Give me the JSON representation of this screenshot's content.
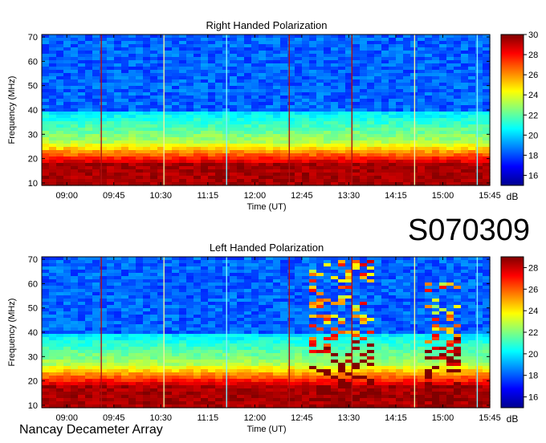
{
  "observation_id": "S070309",
  "observatory": "Nancay Decameter Array",
  "chart_data": [
    {
      "type": "heatmap",
      "title": "Right Handed Polarization",
      "xlabel": "Time (UT)",
      "ylabel": "Frequency (MHz)",
      "x_ticks": [
        "09:00",
        "09:45",
        "10:30",
        "11:15",
        "12:00",
        "12:45",
        "13:30",
        "14:15",
        "15:00",
        "15:45"
      ],
      "y_ticks": [
        10,
        20,
        30,
        40,
        50,
        60,
        70
      ],
      "ylim": [
        9,
        71
      ],
      "colorbar": {
        "unit": "dB",
        "range": [
          15,
          30
        ],
        "ticks": [
          16,
          18,
          20,
          22,
          24,
          26,
          28,
          30
        ]
      },
      "colormap": "jet",
      "marker_lines": [
        {
          "time": "09:33",
          "color": "#b01010"
        },
        {
          "time": "10:33",
          "color": "#f0f0a0"
        },
        {
          "time": "11:33",
          "color": "#80f0ff"
        },
        {
          "time": "12:33",
          "color": "#b01010"
        },
        {
          "time": "13:33",
          "color": "#b01010"
        },
        {
          "time": "14:33",
          "color": "#f0f0a0"
        },
        {
          "time": "15:33",
          "color": "#80f0ff"
        }
      ]
    },
    {
      "type": "heatmap",
      "title": "Left Handed Polarization",
      "xlabel": "Time (UT)",
      "ylabel": "Frequency (MHz)",
      "x_ticks": [
        "09:00",
        "09:45",
        "10:30",
        "11:15",
        "12:00",
        "12:45",
        "13:30",
        "14:15",
        "15:00",
        "15:45"
      ],
      "y_ticks": [
        10,
        20,
        30,
        40,
        50,
        60,
        70
      ],
      "ylim": [
        9,
        71
      ],
      "colorbar": {
        "unit": "dB",
        "range": [
          15,
          29
        ],
        "ticks": [
          16,
          18,
          20,
          22,
          24,
          26,
          28
        ]
      },
      "colormap": "jet",
      "marker_lines": [
        {
          "time": "09:33",
          "color": "#b01010"
        },
        {
          "time": "10:33",
          "color": "#f0f0a0"
        },
        {
          "time": "11:33",
          "color": "#80f0ff"
        },
        {
          "time": "12:33",
          "color": "#b01010"
        },
        {
          "time": "13:33",
          "color": "#b01010"
        },
        {
          "time": "14:33",
          "color": "#f0f0a0"
        },
        {
          "time": "15:33",
          "color": "#80f0ff"
        }
      ],
      "bursts": [
        {
          "start": "12:50",
          "end": "13:55",
          "max_freq": 70
        },
        {
          "start": "14:40",
          "end": "15:20",
          "max_freq": 60
        }
      ]
    }
  ]
}
